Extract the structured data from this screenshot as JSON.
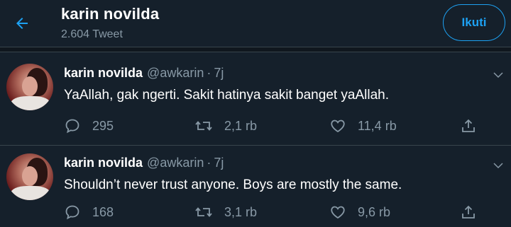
{
  "header": {
    "title": "karin novilda",
    "tweet_count": "2.604 Tweet",
    "follow_label": "Ikuti",
    "accent_color": "#1da1f2"
  },
  "tweets": [
    {
      "name": "karin novilda",
      "handle": "@awkarin",
      "dot": "·",
      "time": "7j",
      "text": "YaAllah, gak ngerti. Sakit hatinya sakit banget yaAllah.",
      "replies": "295",
      "retweets": "2,1 rb",
      "likes": "11,4 rb"
    },
    {
      "name": "karin novilda",
      "handle": "@awkarin",
      "dot": "·",
      "time": "7j",
      "text": "Shouldn’t never trust anyone. Boys are mostly the same.",
      "replies": "168",
      "retweets": "3,1 rb",
      "likes": "9,6 rb"
    }
  ],
  "icons": {
    "back": "arrow-left-icon",
    "caret": "chevron-down-icon",
    "reply": "reply-icon",
    "retweet": "retweet-icon",
    "like": "heart-icon",
    "share": "share-icon"
  }
}
